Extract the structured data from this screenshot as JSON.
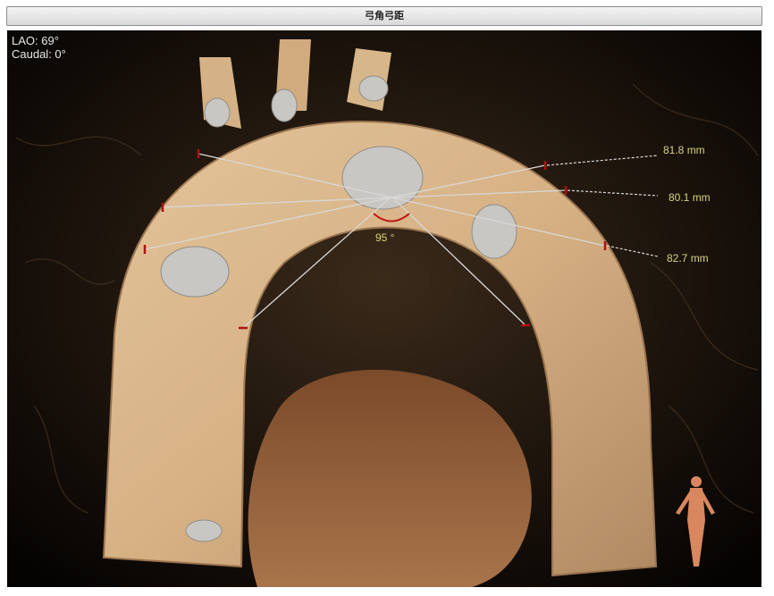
{
  "window": {
    "title": "弓角弓距"
  },
  "view": {
    "lao": "LAO: 69°",
    "caudal": "Caudal: 0°"
  },
  "measurements": {
    "m1": "81.8 mm",
    "m2": "80.1 mm",
    "m3": "82.7 mm",
    "angle": "95 °"
  },
  "colors": {
    "measure_text": "#d8d47a",
    "marker": "#b01010",
    "line": "#d8d8d8"
  },
  "icons": {
    "orientation": "human-figure-icon"
  }
}
